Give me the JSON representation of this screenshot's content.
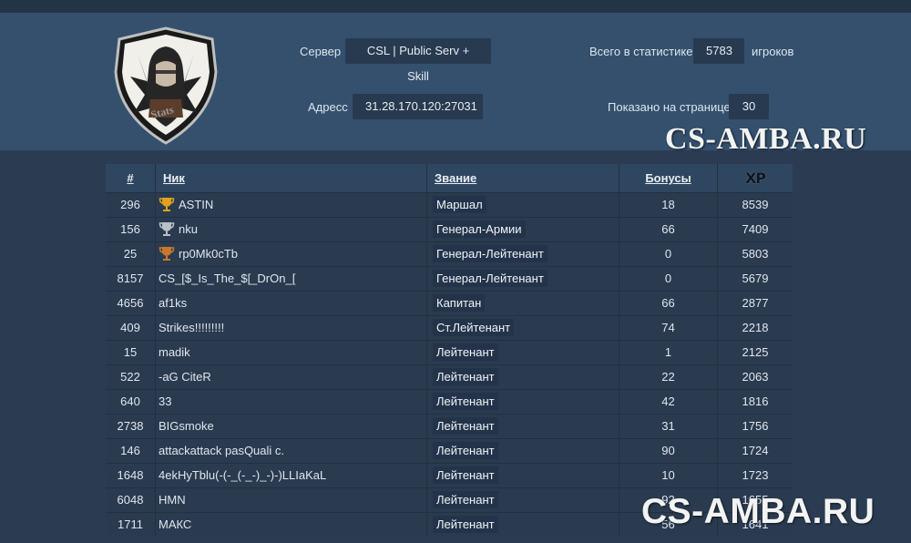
{
  "header": {
    "server_label": "Сервер",
    "server_value": "CSL | Public Serv + Skill",
    "address_label": "Адресс",
    "address_value": "31.28.170.120:27031",
    "total_label": "Всего в статистике",
    "total_value": "5783",
    "total_suffix": "игроков",
    "per_page_label": "Показано на странице",
    "per_page_value": "30"
  },
  "watermark": {
    "top": "CS-AMBA.RU",
    "bottom": "CS-AMBA.RU"
  },
  "table": {
    "columns": {
      "num": "#",
      "nick": "Ник",
      "rank": "Звание",
      "bonus": "Бонусы",
      "xp": "XP"
    },
    "rows": [
      {
        "num": "296",
        "nick": "ASTIN",
        "rank": "Маршал",
        "bonus": "18",
        "xp": "8539",
        "trophy": "gold"
      },
      {
        "num": "156",
        "nick": "nku",
        "rank": "Генерал-Армии",
        "bonus": "66",
        "xp": "7409",
        "trophy": "silver"
      },
      {
        "num": "25",
        "nick": "rp0Mk0cTb",
        "rank": "Генерал-Лейтенант",
        "bonus": "0",
        "xp": "5803",
        "trophy": "bronze"
      },
      {
        "num": "8157",
        "nick": "CS_[$_Is_The_$[_DrOn_[",
        "rank": "Генерал-Лейтенант",
        "bonus": "0",
        "xp": "5679",
        "trophy": ""
      },
      {
        "num": "4656",
        "nick": "af1ks",
        "rank": "Капитан",
        "bonus": "66",
        "xp": "2877",
        "trophy": ""
      },
      {
        "num": "409",
        "nick": "Strikes!!!!!!!!!",
        "rank": "Ст.Лейтенант",
        "bonus": "74",
        "xp": "2218",
        "trophy": ""
      },
      {
        "num": "15",
        "nick": "madik",
        "rank": "Лейтенант",
        "bonus": "1",
        "xp": "2125",
        "trophy": ""
      },
      {
        "num": "522",
        "nick": "-aG CiteR",
        "rank": "Лейтенант",
        "bonus": "22",
        "xp": "2063",
        "trophy": ""
      },
      {
        "num": "640",
        "nick": "33",
        "rank": "Лейтенант",
        "bonus": "42",
        "xp": "1816",
        "trophy": ""
      },
      {
        "num": "2738",
        "nick": "BIGsmoke",
        "rank": "Лейтенант",
        "bonus": "31",
        "xp": "1756",
        "trophy": ""
      },
      {
        "num": "146",
        "nick": "attackattack pasQuali c.",
        "rank": "Лейтенант",
        "bonus": "90",
        "xp": "1724",
        "trophy": ""
      },
      {
        "num": "1648",
        "nick": "4ekHyTblu(-(-_(-_-)_-)-)LLIaKaL",
        "rank": "Лейтенант",
        "bonus": "10",
        "xp": "1723",
        "trophy": ""
      },
      {
        "num": "6048",
        "nick": "HMN",
        "rank": "Лейтенант",
        "bonus": "92",
        "xp": "1655",
        "trophy": ""
      },
      {
        "num": "1711",
        "nick": "МАКС",
        "rank": "Лейтенант",
        "bonus": "56",
        "xp": "1641",
        "trophy": ""
      }
    ]
  },
  "colors": {
    "gold": "#e0a21c",
    "silver": "#b8c0c8",
    "bronze": "#c8772e"
  }
}
